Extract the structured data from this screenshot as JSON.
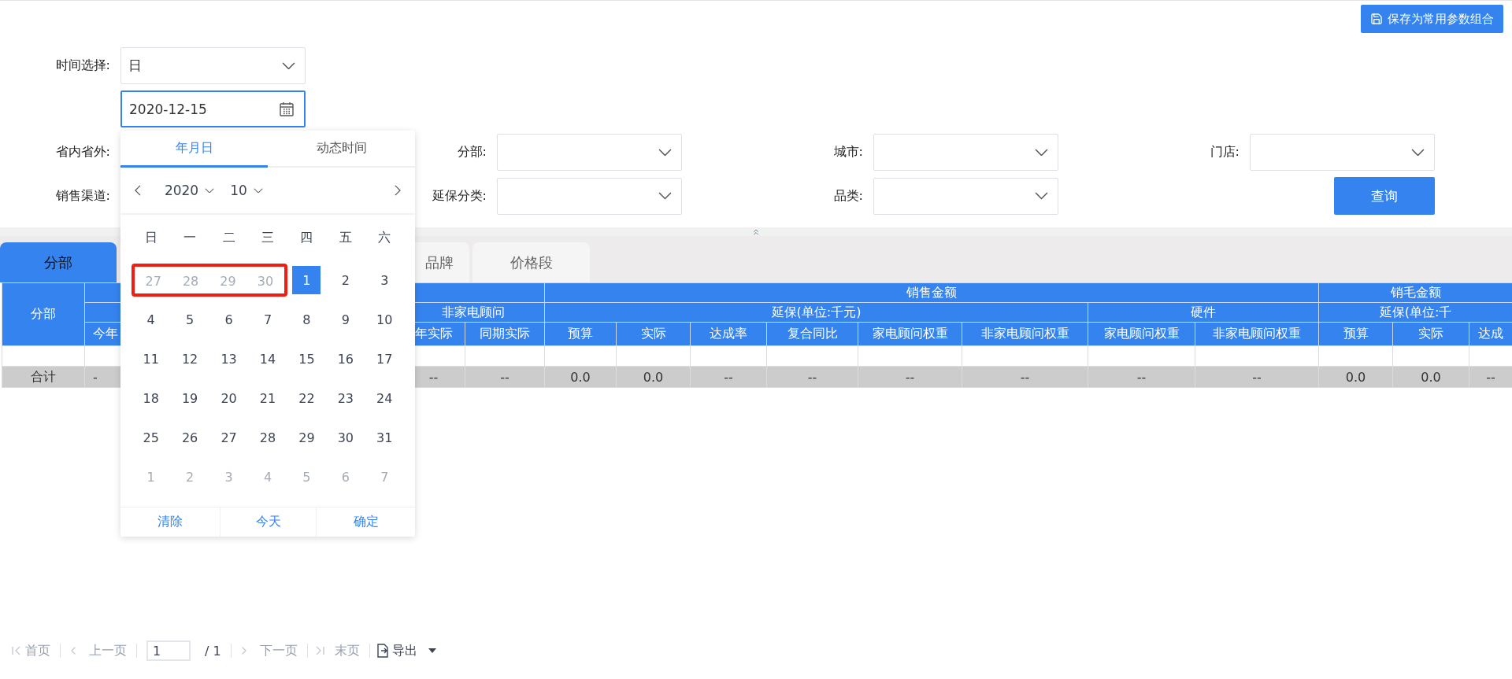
{
  "toolbar": {
    "save_button": "保存为常用参数组合"
  },
  "time_filter": {
    "label": "时间选择:",
    "value": "日",
    "date": "2020-12-15"
  },
  "filter_rows": [
    [
      {
        "kind": "select",
        "label": "省内省外:"
      },
      {
        "kind": "select",
        "label": "分部:"
      },
      {
        "kind": "select",
        "label": "城市:"
      },
      {
        "kind": "select",
        "label": "门店:"
      }
    ],
    [
      {
        "kind": "select",
        "label": "销售渠道:"
      },
      {
        "kind": "select",
        "label": "延保分类:"
      },
      {
        "kind": "select",
        "label": "品类:"
      },
      {
        "kind": "button",
        "label": "查询"
      }
    ]
  ],
  "tabs": [
    {
      "label": "分部",
      "selected": true
    },
    {
      "label": "品牌",
      "selected": false
    },
    {
      "label": "价格段",
      "selected": false
    }
  ],
  "table": {
    "header": [
      {
        "label": "分部"
      },
      {
        "children": [
          {
            "children": [
              {
                "label": "今年"
              }
            ]
          },
          {
            "label": "非家电顾问",
            "children": [
              {
                "label": "年实际"
              },
              {
                "label": "同期实际"
              }
            ]
          }
        ]
      },
      {
        "label": "销售金额",
        "children": [
          {
            "label": "延保(单位:千元)",
            "children": [
              {
                "label": "预算"
              },
              {
                "label": "实际"
              },
              {
                "label": "达成率"
              },
              {
                "label": "复合同比"
              },
              {
                "label": "家电顾问权重"
              },
              {
                "label": "非家电顾问权重"
              }
            ]
          },
          {
            "label": "硬件",
            "children": [
              {
                "label": "家电顾问权重"
              },
              {
                "label": "非家电顾问权重"
              }
            ]
          }
        ]
      },
      {
        "label": "销毛金额",
        "children": [
          {
            "label": "延保(单位:千",
            "children": [
              {
                "label": "预算"
              },
              {
                "label": "实际"
              },
              {
                "label": "达成"
              }
            ]
          }
        ]
      }
    ],
    "rows": [
      {
        "kind": "empty"
      },
      {
        "kind": "total",
        "cells": [
          "合计",
          "-",
          "--",
          "--",
          "0.0",
          "0.0",
          "--",
          "--",
          "--",
          "--",
          "--",
          "--",
          "0.0",
          "0.0",
          "--"
        ]
      }
    ]
  },
  "date_picker": {
    "tabs": [
      {
        "label": "年月日",
        "selected": true
      },
      {
        "label": "动态时间",
        "selected": false
      }
    ],
    "year": "2020",
    "month": "10",
    "weekdays": [
      "日",
      "一",
      "二",
      "三",
      "四",
      "五",
      "六"
    ],
    "days": [
      {
        "kind": "highlight",
        "children": [
          {
            "d": "27",
            "outside": true,
            "selected": false
          },
          {
            "d": "28",
            "outside": true,
            "selected": false
          },
          {
            "d": "29",
            "outside": true,
            "selected": false
          },
          {
            "d": "30",
            "outside": true,
            "selected": false
          }
        ]
      },
      {
        "d": "1",
        "outside": false,
        "selected": true
      },
      {
        "d": "2",
        "outside": false,
        "selected": false
      },
      {
        "d": "3",
        "outside": false,
        "selected": false
      },
      {
        "d": "4",
        "outside": false,
        "selected": false
      },
      {
        "d": "5",
        "outside": false,
        "selected": false
      },
      {
        "d": "6",
        "outside": false,
        "selected": false
      },
      {
        "d": "7",
        "outside": false,
        "selected": false
      },
      {
        "d": "8",
        "outside": false,
        "selected": false
      },
      {
        "d": "9",
        "outside": false,
        "selected": false
      },
      {
        "d": "10",
        "outside": false,
        "selected": false
      },
      {
        "d": "11",
        "outside": false,
        "selected": false
      },
      {
        "d": "12",
        "outside": false,
        "selected": false
      },
      {
        "d": "13",
        "outside": false,
        "selected": false
      },
      {
        "d": "14",
        "outside": false,
        "selected": false
      },
      {
        "d": "15",
        "outside": false,
        "selected": false
      },
      {
        "d": "16",
        "outside": false,
        "selected": false
      },
      {
        "d": "17",
        "outside": false,
        "selected": false
      },
      {
        "d": "18",
        "outside": false,
        "selected": false
      },
      {
        "d": "19",
        "outside": false,
        "selected": false
      },
      {
        "d": "20",
        "outside": false,
        "selected": false
      },
      {
        "d": "21",
        "outside": false,
        "selected": false
      },
      {
        "d": "22",
        "outside": false,
        "selected": false
      },
      {
        "d": "23",
        "outside": false,
        "selected": false
      },
      {
        "d": "24",
        "outside": false,
        "selected": false
      },
      {
        "d": "25",
        "outside": false,
        "selected": false
      },
      {
        "d": "26",
        "outside": false,
        "selected": false
      },
      {
        "d": "27",
        "outside": false,
        "selected": false
      },
      {
        "d": "28",
        "outside": false,
        "selected": false
      },
      {
        "d": "29",
        "outside": false,
        "selected": false
      },
      {
        "d": "30",
        "outside": false,
        "selected": false
      },
      {
        "d": "31",
        "outside": false,
        "selected": false
      },
      {
        "d": "1",
        "outside": true,
        "selected": false
      },
      {
        "d": "2",
        "outside": true,
        "selected": false
      },
      {
        "d": "3",
        "outside": true,
        "selected": false
      },
      {
        "d": "4",
        "outside": true,
        "selected": false
      },
      {
        "d": "5",
        "outside": true,
        "selected": false
      },
      {
        "d": "6",
        "outside": true,
        "selected": false
      },
      {
        "d": "7",
        "outside": true,
        "selected": false
      }
    ],
    "footer": [
      "清除",
      "今天",
      "确定"
    ]
  },
  "pagination": {
    "first": "首页",
    "prev": "上一页",
    "page": "1",
    "total": "/ 1",
    "next": "下一页",
    "last": "末页",
    "export": "导出"
  }
}
